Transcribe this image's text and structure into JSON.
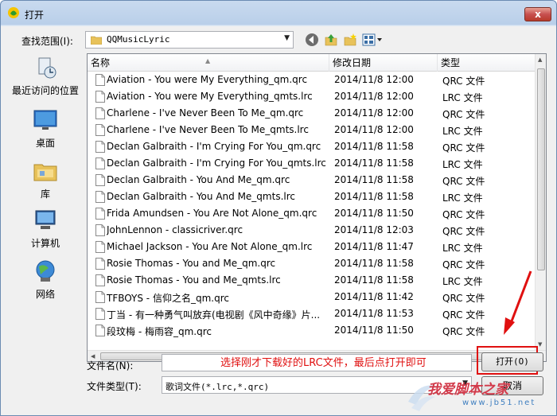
{
  "window": {
    "title": "打开",
    "close_label": "x"
  },
  "lookin": {
    "label": "查找范围(I):",
    "value": "QQMusicLyric"
  },
  "places": [
    {
      "label": "最近访问的位置",
      "icon": "recent-places-icon"
    },
    {
      "label": "桌面",
      "icon": "desktop-icon"
    },
    {
      "label": "库",
      "icon": "libraries-icon"
    },
    {
      "label": "计算机",
      "icon": "computer-icon"
    },
    {
      "label": "网络",
      "icon": "network-icon"
    }
  ],
  "columns": {
    "name": "名称",
    "date": "修改日期",
    "type": "类型"
  },
  "files": [
    {
      "name": "Aviation - You were My Everything_qm.qrc",
      "date": "2014/11/8 12:00",
      "type": "QRC 文件"
    },
    {
      "name": "Aviation - You were My Everything_qmts.lrc",
      "date": "2014/11/8 12:00",
      "type": "LRC 文件"
    },
    {
      "name": "Charlene - I've Never Been To Me_qm.qrc",
      "date": "2014/11/8 12:00",
      "type": "QRC 文件"
    },
    {
      "name": "Charlene - I've Never Been To Me_qmts.lrc",
      "date": "2014/11/8 12:00",
      "type": "LRC 文件"
    },
    {
      "name": "Declan Galbraith - I'm Crying For You_qm.qrc",
      "date": "2014/11/8 11:58",
      "type": "QRC 文件"
    },
    {
      "name": "Declan Galbraith - I'm Crying For You_qmts.lrc",
      "date": "2014/11/8 11:58",
      "type": "LRC 文件"
    },
    {
      "name": "Declan Galbraith - You And Me_qm.qrc",
      "date": "2014/11/8 11:58",
      "type": "QRC 文件"
    },
    {
      "name": "Declan Galbraith - You And Me_qmts.lrc",
      "date": "2014/11/8 11:58",
      "type": "LRC 文件"
    },
    {
      "name": "Frida Amundsen - You Are Not Alone_qm.qrc",
      "date": "2014/11/8 11:50",
      "type": "QRC 文件"
    },
    {
      "name": "JohnLennon - classicriver.qrc",
      "date": "2014/11/8 12:03",
      "type": "QRC 文件"
    },
    {
      "name": "Michael Jackson - You Are Not Alone_qm.lrc",
      "date": "2014/11/8 11:47",
      "type": "LRC 文件"
    },
    {
      "name": "Rosie Thomas - You and Me_qm.qrc",
      "date": "2014/11/8 11:58",
      "type": "QRC 文件"
    },
    {
      "name": "Rosie Thomas - You and Me_qmts.lrc",
      "date": "2014/11/8 11:58",
      "type": "LRC 文件"
    },
    {
      "name": "TFBOYS - 信仰之名_qm.qrc",
      "date": "2014/11/8 11:42",
      "type": "QRC 文件"
    },
    {
      "name": "丁当 - 有一种勇气叫放弃(电视剧《风中奇缘》片...",
      "date": "2014/11/8 11:53",
      "type": "QRC 文件"
    },
    {
      "name": "段玟梅 - 梅雨容_qm.qrc",
      "date": "2014/11/8 11:50",
      "type": "QRC 文件"
    }
  ],
  "filename": {
    "label": "文件名(N):",
    "value": ""
  },
  "filetype": {
    "label": "文件类型(T):",
    "value": "歌词文件(*.lrc,*.qrc)"
  },
  "buttons": {
    "open": "打开(O)",
    "cancel": "取消"
  },
  "annotation": {
    "text": "选择刚才下载好的LRC文件，最后点打开即可",
    "color": "#e01010"
  },
  "watermark": {
    "main": "我爱脚本之家",
    "url": "www.jb51.net"
  }
}
